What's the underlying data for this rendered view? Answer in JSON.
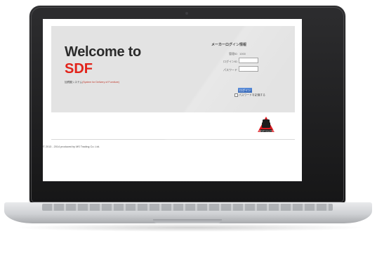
{
  "welcome": {
    "line1": "Welcome to",
    "line2": "SDF",
    "subtitle_jp": "加賀屋システム",
    "subtitle_en": "(System for Delivery of Furniture)"
  },
  "login": {
    "title": "メーカーログイン情報",
    "id_label": "管理ID",
    "id_value": "1000",
    "login_id_label": "ログインID",
    "password_label": "パスワード",
    "button_label": "ログイン",
    "remember_label": "パスワードを記憶する"
  },
  "logo": {
    "text": "COMFORT SOLUTIONS",
    "icon": "chair-logo-icon"
  },
  "footer": {
    "text": "© 2013 - 2014 produced by MS Trading Co. Ltd."
  },
  "colors": {
    "accent": "#e2231a",
    "button": "#2a5db0",
    "panel": "#e3e3e3"
  }
}
